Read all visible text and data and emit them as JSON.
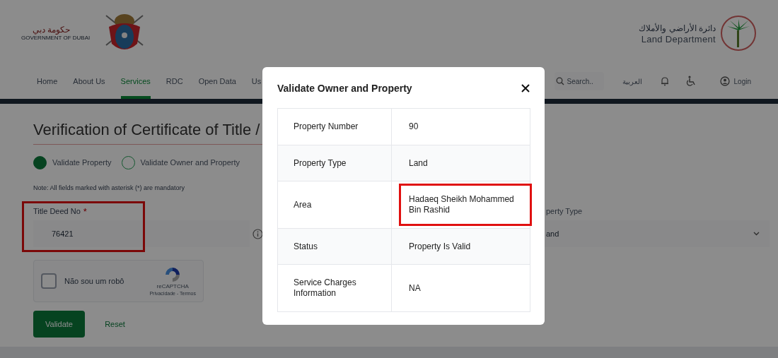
{
  "header": {
    "gov_logo": {
      "arabic": "حكومة دبي",
      "english": "GOVERNMENT OF DUBAI"
    },
    "dept_logo": {
      "arabic": "دائرة الأراضي والأملاك",
      "english": "Land Department"
    },
    "nav": [
      {
        "label": "Home",
        "selected": false
      },
      {
        "label": "About Us",
        "selected": false
      },
      {
        "label": "Services",
        "selected": true
      },
      {
        "label": "RDC",
        "selected": false
      },
      {
        "label": "Open Data",
        "selected": false
      },
      {
        "label": "Us",
        "selected": false
      }
    ],
    "search": {
      "placeholder": "Search.."
    },
    "language": "العربية",
    "login": "Login"
  },
  "form": {
    "title": "Verification of Certificate of Title /",
    "options": [
      {
        "label": "Validate Property",
        "selected": true
      },
      {
        "label": "Validate Owner and Property",
        "selected": false
      }
    ],
    "note": "Note: All fields marked with asterisk (*) are mandatory",
    "title_deed": {
      "label": "Title Deed No",
      "required_mark": "*",
      "value": "76421",
      "highlighted": true
    },
    "property_type": {
      "label": "perty Type",
      "value": "and"
    },
    "captcha": {
      "label": "Não sou um robô",
      "checked": false,
      "brand": "reCAPTCHA",
      "links": "Privacidade - Termos"
    },
    "buttons": [
      {
        "label": "Validate",
        "kind": "primary"
      },
      {
        "label": "Reset",
        "kind": "secondary"
      }
    ]
  },
  "modal": {
    "title": "Validate Owner and Property",
    "rows": [
      {
        "label": "Property Number",
        "value": "90",
        "highlighted": false
      },
      {
        "label": "Property Type",
        "value": "Land",
        "highlighted": false
      },
      {
        "label": "Area",
        "value": "Hadaeq Sheikh Mohammed Bin Rashid",
        "highlighted": true
      },
      {
        "label": "Status",
        "value": "Property Is Valid",
        "highlighted": false
      },
      {
        "label": "Service Charges Information",
        "value": "NA",
        "highlighted": false
      }
    ]
  }
}
